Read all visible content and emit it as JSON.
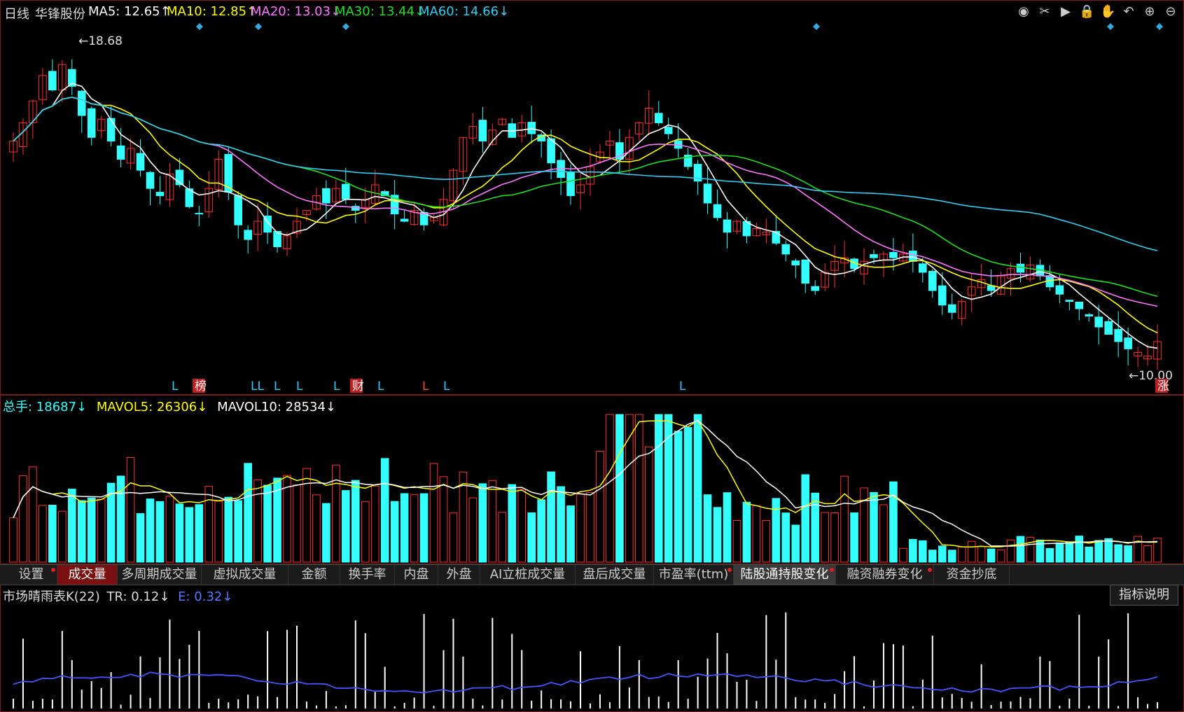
{
  "header": {
    "period": "日线",
    "stock_name": "华锋股份",
    "ma5": "MA5: 12.65↑",
    "ma10": "MA10: 12.85↑",
    "ma20": "MA20: 13.03↓",
    "ma30": "MA30: 13.44↓",
    "ma60": "MA60: 14.66↓",
    "tools": [
      "eye-icon",
      "scissors-icon",
      "play-icon",
      "lock-icon",
      "hand-icon",
      "undo-icon",
      "zoom-in-icon",
      "zoom-out-icon"
    ]
  },
  "price_chart": {
    "high_label": "18.68",
    "low_label": "10.00",
    "high": 18.68,
    "low": 10.0,
    "event_markers": [
      {
        "text": "L",
        "color": "#33ccff"
      },
      {
        "text": "榜",
        "color": "#ffffff",
        "bg": "#c02020"
      },
      {
        "text": "LL",
        "color": "#33ccff"
      },
      {
        "text": "L",
        "color": "#33ccff"
      },
      {
        "text": "L",
        "color": "#33ccff"
      },
      {
        "text": "L",
        "color": "#33ccff"
      },
      {
        "text": "财",
        "color": "#ffffff",
        "bg": "#c02020"
      },
      {
        "text": "L",
        "color": "#33ccff"
      },
      {
        "text": "L",
        "color": "#ff4444"
      },
      {
        "text": "L",
        "color": "#33ccff"
      },
      {
        "text": "L",
        "color": "#33ccff"
      },
      {
        "text": "涨",
        "color": "#ffffff",
        "bg": "#c02020"
      }
    ]
  },
  "volume_header": {
    "total": "总手: 18687↓",
    "mavol5": "MAVOL5: 26306↓",
    "mavol10": "MAVOL10: 28534↓"
  },
  "tabs": [
    {
      "label": "设置",
      "dot": true
    },
    {
      "label": "成交量",
      "active": true
    },
    {
      "label": "多周期成交量"
    },
    {
      "label": "虚拟成交量"
    },
    {
      "label": "金额"
    },
    {
      "label": "换手率"
    },
    {
      "label": "内盘"
    },
    {
      "label": "外盘"
    },
    {
      "label": "AI立桩成交量"
    },
    {
      "label": "盘后成交量"
    },
    {
      "label": "市盈率(ttm)",
      "dot": true
    },
    {
      "label": "陆股通持股变化",
      "selected": true,
      "dot": true
    },
    {
      "label": "融资融券变化",
      "dot": true
    },
    {
      "label": "资金抄底"
    }
  ],
  "indicator_header": {
    "name": "市场晴雨表K(22)",
    "tr": "TR: 0.12↓",
    "e": "E: 0.32↓"
  },
  "info_button": "指标说明",
  "colors": {
    "up": "#ff3030",
    "down": "#33ffff",
    "ma5": "#ffffff",
    "ma10": "#ffff00",
    "ma20": "#ff77ff",
    "ma30": "#22dd22",
    "ma60": "#33ccee",
    "border": "#7a1d1d"
  },
  "chart_data": {
    "type": "candlestick",
    "close_series": [
      16.1,
      16.6,
      17.2,
      17.9,
      17.5,
      18.2,
      17.6,
      16.8,
      16.2,
      16.7,
      16.1,
      15.6,
      15.9,
      15.3,
      14.8,
      14.6,
      15.2,
      14.9,
      14.3,
      14.1,
      14.8,
      15.6,
      14.7,
      13.8,
      13.4,
      13.9,
      13.6,
      13.2,
      13.5,
      13.9,
      14.2,
      14.6,
      14.4,
      14.8,
      14.5,
      14.2,
      14.5,
      14.9,
      14.6,
      14.1,
      13.9,
      14.2,
      13.8,
      14.0,
      14.5,
      15.3,
      16.2,
      16.5,
      16.1,
      16.4,
      16.7,
      16.2,
      16.6,
      16.3,
      16.1,
      15.5,
      15.1,
      14.6,
      14.9,
      15.4,
      15.8,
      16.1,
      15.6,
      16.2,
      16.6,
      17.0,
      16.6,
      16.3,
      15.9,
      15.4,
      15.0,
      14.4,
      14.0,
      13.6,
      13.9,
      13.5,
      13.7,
      13.6,
      13.3,
      13.0,
      12.7,
      12.2,
      12.0,
      12.5,
      12.8,
      12.9,
      12.6,
      12.8,
      12.9,
      13.0,
      12.9,
      13.0,
      12.8,
      12.5,
      12.0,
      11.6,
      11.4,
      11.7,
      12.1,
      12.3,
      12.0,
      12.4,
      12.6,
      12.5,
      12.7,
      12.4,
      12.1,
      11.9,
      11.7,
      11.5,
      11.3,
      11.0,
      10.8,
      10.6,
      10.4,
      10.3,
      10.2,
      10.6
    ]
  }
}
